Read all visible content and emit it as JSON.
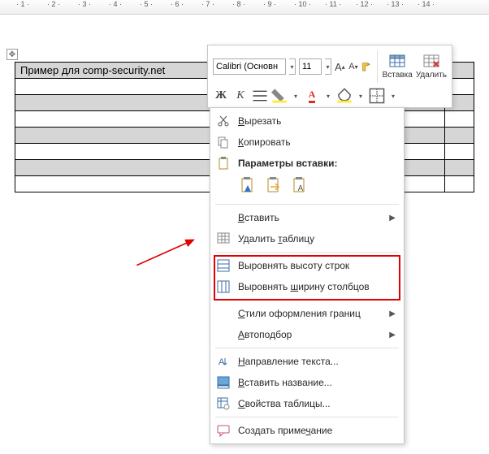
{
  "ruler": {
    "marks": [
      1,
      2,
      3,
      4,
      5,
      6,
      7,
      8,
      9,
      10,
      11,
      12,
      13,
      14
    ]
  },
  "table": {
    "row0_cells": [
      "Пример для comp-security.net",
      ""
    ]
  },
  "mini_toolbar": {
    "font_name": "Calibri (Основн",
    "font_size": "11",
    "btn_increase": "A",
    "btn_decrease": "A",
    "insert_label": "Вставка",
    "delete_label": "Удалить",
    "bold": "Ж",
    "italic": "К"
  },
  "ctx": {
    "cut": "Вырезать",
    "copy": "Копировать",
    "paste_opts": "Параметры вставки:",
    "insert": "Вставить",
    "delete_table": "Удалить таблицу",
    "equal_rows": "Выровнять высоту строк",
    "equal_cols": "Выровнять ширину столбцов",
    "border_styles": "Стили оформления границ",
    "autofit": "Автоподбор",
    "text_dir": "Направление текста...",
    "insert_caption": "Вставить название...",
    "table_props": "Свойства таблицы...",
    "new_comment": "Создать примечание"
  }
}
